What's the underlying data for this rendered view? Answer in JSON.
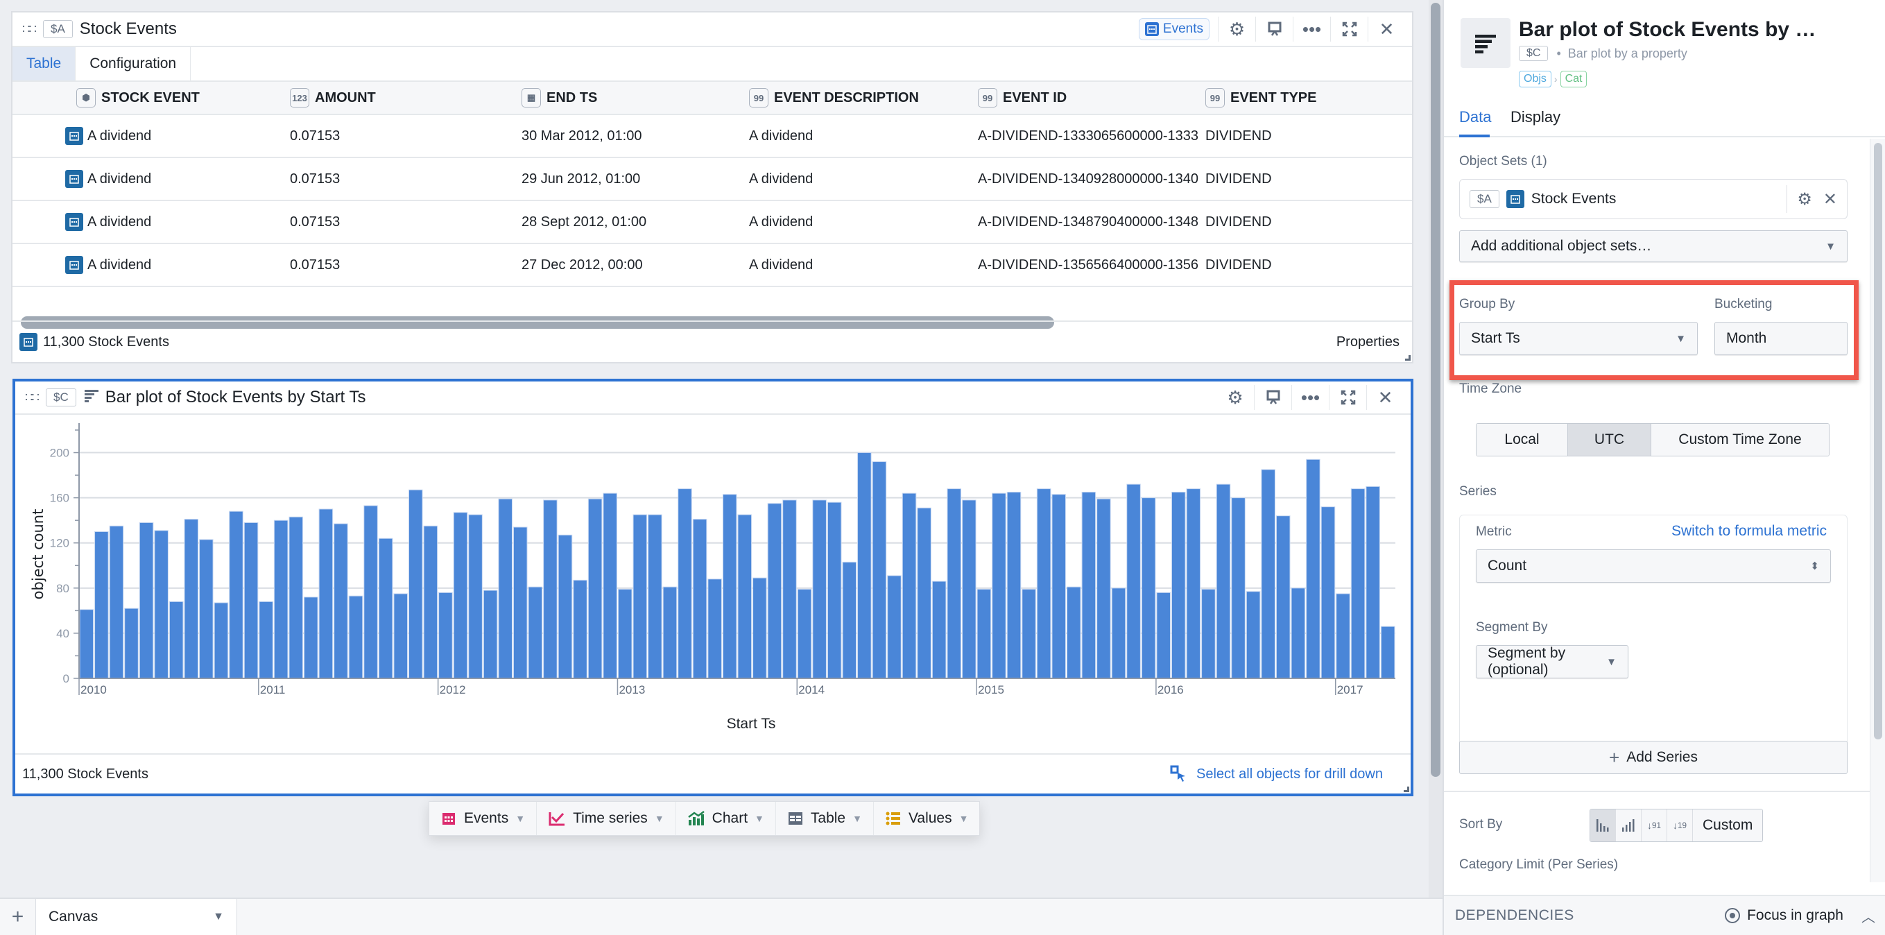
{
  "table_widget": {
    "var": "$A",
    "title": "Stock Events",
    "events_chip": "Events",
    "tabs": [
      {
        "label": "Table",
        "active": true
      },
      {
        "label": "Configuration",
        "active": false
      }
    ],
    "columns": [
      {
        "label": "STOCK EVENT",
        "icon": "object-type-icon"
      },
      {
        "label": "AMOUNT",
        "icon": "number-icon",
        "icon_text": "123"
      },
      {
        "label": "END TS",
        "icon": "calendar-icon"
      },
      {
        "label": "EVENT DESCRIPTION",
        "icon": "string-icon",
        "icon_text": "99"
      },
      {
        "label": "EVENT ID",
        "icon": "string-icon",
        "icon_text": "99"
      },
      {
        "label": "EVENT TYPE",
        "icon": "string-icon",
        "icon_text": "99"
      }
    ],
    "rows": [
      [
        "A dividend",
        "0.07153",
        "30 Mar 2012, 01:00",
        "A dividend",
        "A-DIVIDEND-1333065600000-1333",
        "DIVIDEND"
      ],
      [
        "A dividend",
        "0.07153",
        "29 Jun 2012, 01:00",
        "A dividend",
        "A-DIVIDEND-1340928000000-1340",
        "DIVIDEND"
      ],
      [
        "A dividend",
        "0.07153",
        "28 Sept 2012, 01:00",
        "A dividend",
        "A-DIVIDEND-1348790400000-1348",
        "DIVIDEND"
      ],
      [
        "A dividend",
        "0.07153",
        "27 Dec 2012, 00:00",
        "A dividend",
        "A-DIVIDEND-1356566400000-1356",
        "DIVIDEND"
      ]
    ],
    "footer_count": "11,300 Stock Events",
    "footer_properties": "Properties"
  },
  "chart_widget": {
    "var": "$C",
    "title": "Bar plot of Stock Events by Start Ts",
    "footer_count": "11,300 Stock Events",
    "drill_down": "Select all objects for drill down"
  },
  "chart_data": {
    "type": "bar",
    "title": "Bar plot of Stock Events by Start Ts",
    "xlabel": "Start Ts",
    "ylabel": "object count",
    "ylim": [
      0,
      220
    ],
    "yticks": [
      0,
      40,
      80,
      120,
      160,
      200
    ],
    "xtick_labels": [
      "2010",
      "2011",
      "2012",
      "2013",
      "2014",
      "2015",
      "2016",
      "2017"
    ],
    "grid": true,
    "bar_color": "#4a86d8",
    "bucketing": "Month",
    "start": "2010-01",
    "categories": [
      "2010-01",
      "2010-02",
      "2010-03",
      "2010-04",
      "2010-05",
      "2010-06",
      "2010-07",
      "2010-08",
      "2010-09",
      "2010-10",
      "2010-11",
      "2010-12",
      "2011-01",
      "2011-02",
      "2011-03",
      "2011-04",
      "2011-05",
      "2011-06",
      "2011-07",
      "2011-08",
      "2011-09",
      "2011-10",
      "2011-11",
      "2011-12",
      "2012-01",
      "2012-02",
      "2012-03",
      "2012-04",
      "2012-05",
      "2012-06",
      "2012-07",
      "2012-08",
      "2012-09",
      "2012-10",
      "2012-11",
      "2012-12",
      "2013-01",
      "2013-02",
      "2013-03",
      "2013-04",
      "2013-05",
      "2013-06",
      "2013-07",
      "2013-08",
      "2013-09",
      "2013-10",
      "2013-11",
      "2013-12",
      "2014-01",
      "2014-02",
      "2014-03",
      "2014-04",
      "2014-05",
      "2014-06",
      "2014-07",
      "2014-08",
      "2014-09",
      "2014-10",
      "2014-11",
      "2014-12",
      "2015-01",
      "2015-02",
      "2015-03",
      "2015-04",
      "2015-05",
      "2015-06",
      "2015-07",
      "2015-08",
      "2015-09",
      "2015-10",
      "2015-11",
      "2015-12",
      "2016-01",
      "2016-02",
      "2016-03",
      "2016-04",
      "2016-05",
      "2016-06",
      "2016-07",
      "2016-08",
      "2016-09",
      "2016-10",
      "2016-11",
      "2016-12",
      "2017-01",
      "2017-02",
      "2017-03",
      "2017-04"
    ],
    "values": [
      61,
      130,
      135,
      62,
      138,
      131,
      68,
      141,
      123,
      67,
      148,
      138,
      68,
      140,
      143,
      72,
      150,
      137,
      73,
      153,
      124,
      75,
      167,
      135,
      76,
      147,
      145,
      78,
      159,
      134,
      81,
      158,
      127,
      87,
      159,
      164,
      79,
      145,
      145,
      81,
      168,
      141,
      88,
      163,
      145,
      89,
      155,
      158,
      79,
      158,
      156,
      103,
      200,
      192,
      91,
      164,
      151,
      86,
      168,
      158,
      79,
      164,
      165,
      79,
      168,
      163,
      81,
      165,
      159,
      80,
      172,
      160,
      76,
      165,
      168,
      79,
      172,
      160,
      77,
      185,
      144,
      80,
      194,
      152,
      75,
      168,
      170,
      46
    ]
  },
  "toolbar": {
    "items": [
      {
        "label": "Events",
        "icon": "calendar-icon",
        "color": "#db2c6f"
      },
      {
        "label": "Time series",
        "icon": "line-chart-icon",
        "color": "#db2c6f"
      },
      {
        "label": "Chart",
        "icon": "chart-icon",
        "color": "#238551"
      },
      {
        "label": "Table",
        "icon": "table-icon",
        "color": "#5f6b7c"
      },
      {
        "label": "Values",
        "icon": "list-icon",
        "color": "#d99e0b"
      }
    ]
  },
  "bottom_bar": {
    "canvas_tab": "Canvas"
  },
  "right_panel": {
    "title": "Bar plot of Stock Events by …",
    "var": "$C",
    "subtitle": "Bar plot by a property",
    "badges": [
      "Objs",
      "Cat"
    ],
    "tabs": [
      {
        "label": "Data",
        "active": true
      },
      {
        "label": "Display",
        "active": false
      }
    ],
    "object_sets_label": "Object Sets (1)",
    "object_set": {
      "var": "$A",
      "name": "Stock Events"
    },
    "add_object_sets": "Add additional object sets…",
    "group_by_label": "Group By",
    "group_by_value": "Start Ts",
    "bucketing_label": "Bucketing",
    "bucketing_value": "Month",
    "time_zone_label": "Time Zone",
    "time_zone_options": [
      {
        "label": "Local",
        "active": false
      },
      {
        "label": "UTC",
        "active": true
      },
      {
        "label": "Custom Time Zone",
        "active": false
      }
    ],
    "series_label": "Series",
    "metric_label": "Metric",
    "formula_link": "Switch to formula metric",
    "metric_value": "Count",
    "segment_by_label": "Segment By",
    "segment_by_placeholder": "Segment by (optional)",
    "add_series": "Add Series",
    "sort_by_label": "Sort By",
    "sort_options": [
      "default-order",
      "ascending-bars",
      "descending-9-1",
      "ascending-1-9"
    ],
    "sort_custom": "Custom",
    "category_limit_label": "Category Limit (Per Series)",
    "dependencies": "DEPENDENCIES",
    "focus_in_graph": "Focus in graph"
  }
}
